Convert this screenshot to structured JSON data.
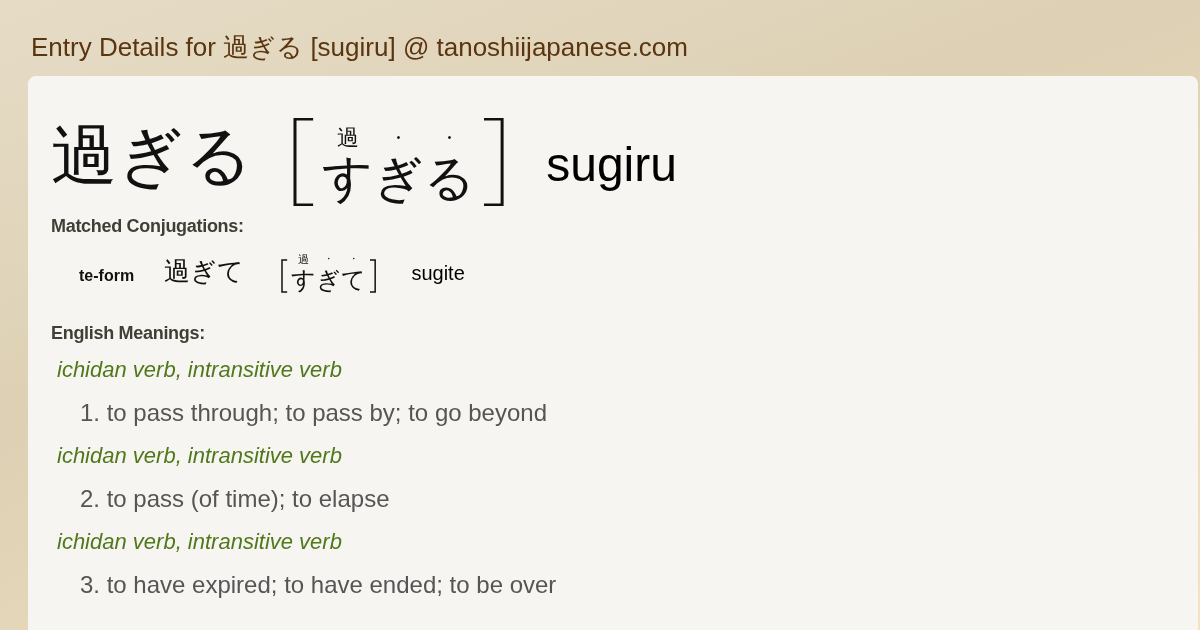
{
  "page_title": "Entry Details for 過ぎる [sugiru] @ tanoshiijapanese.com",
  "entry": {
    "word": "過ぎる",
    "reading": [
      {
        "kana": "す",
        "ruby": "過"
      },
      {
        "kana": "ぎ",
        "ruby": "·"
      },
      {
        "kana": "る",
        "ruby": "·"
      }
    ],
    "romaji": "sugiru"
  },
  "conjugations": {
    "heading": "Matched Conjugations:",
    "items": [
      {
        "form": "te-form",
        "word": "過ぎて",
        "reading": [
          {
            "kana": "す",
            "ruby": "過"
          },
          {
            "kana": "ぎ",
            "ruby": "·"
          },
          {
            "kana": "て",
            "ruby": "·"
          }
        ],
        "romaji": "sugite"
      }
    ]
  },
  "meanings": {
    "heading": "English Meanings:",
    "items": [
      {
        "pos": "ichidan verb, intransitive verb",
        "definition": "1. to pass through; to pass by; to go beyond"
      },
      {
        "pos": "ichidan verb, intransitive verb",
        "definition": "2. to pass (of time); to elapse"
      },
      {
        "pos": "ichidan verb, intransitive verb",
        "definition": "3. to have expired; to have ended; to be over"
      }
    ]
  }
}
